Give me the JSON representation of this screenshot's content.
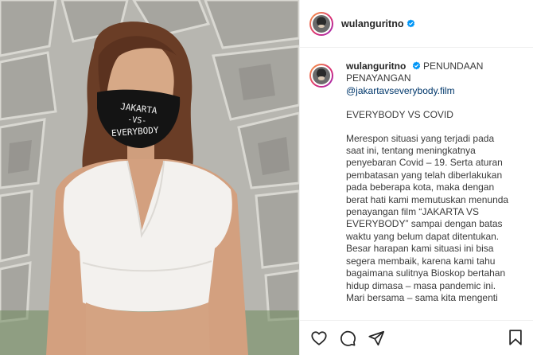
{
  "post": {
    "username": "wulanguritno",
    "verified": true
  },
  "caption": {
    "username": "wulanguritno",
    "title": "PENUNDAAN PENAYANGAN",
    "mention": "@jakartavseverybody.film",
    "heading": "EVERYBODY VS COVID",
    "body": "Merespon situasi yang terjadi pada saat ini, tentang meningkatnya penyebaran Covid – 19. Serta aturan pembatasan yang telah diberlakukan pada beberapa kota, maka dengan berat hati kami memutuskan menunda penayangan film “JAKARTA VS EVERYBODY” sampai dengan batas waktu yang belum dapat ditentukan. Besar harapan kami situasi ini bisa segera membaik, karena kami tahu bagaimana sulitnya Bioskop  bertahan hidup dimasa – masa pandemic ini.",
    "continuation": "Mari bersama – sama kita mengenti"
  },
  "photo": {
    "mask_text_line1": "JAKARTA",
    "mask_text_line2": "-VS-",
    "mask_text_line3": "EVERYBODY"
  },
  "icons": {
    "like": "heart-icon",
    "comment": "comment-icon",
    "share": "share-icon",
    "save": "bookmark-icon",
    "verified": "verified-badge-icon"
  },
  "colors": {
    "verified_blue": "#0095f6",
    "mention_blue": "#00376b",
    "story_ring_start": "#f9a03f",
    "story_ring_end": "#962fbf"
  }
}
